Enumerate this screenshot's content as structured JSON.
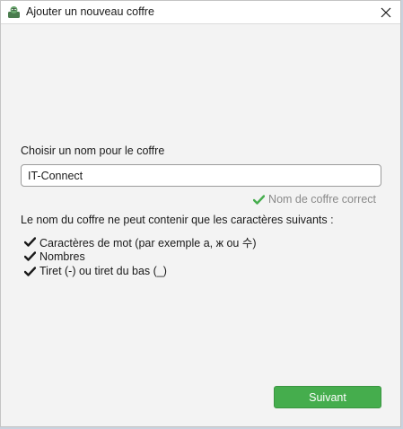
{
  "window": {
    "title": "Ajouter un nouveau coffre",
    "app_icon": "keepassxc-icon",
    "close_icon": "close-icon"
  },
  "form": {
    "name_label": "Choisir un nom pour le coffre",
    "name_value": "IT-Connect",
    "validation_message": "Nom de coffre correct",
    "validation_icon": "check-icon",
    "valid_color": "#45ad4d"
  },
  "rules": {
    "intro": "Le nom du coffre ne peut contenir que les caractères suivants :",
    "items": [
      {
        "label": "Caractères de mot (par exemple a, ж ou 수)"
      },
      {
        "label": "Nombres"
      },
      {
        "label": "Tiret (-) ou tiret du bas (_)"
      }
    ]
  },
  "footer": {
    "next_label": "Suivant",
    "next_color": "#45ad4d"
  }
}
